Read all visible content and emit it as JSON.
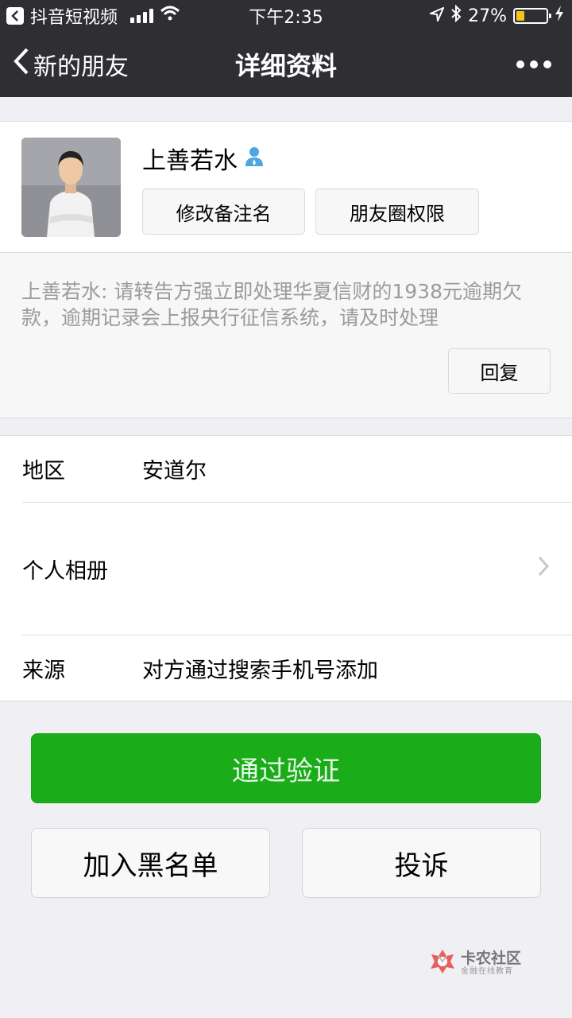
{
  "status_bar": {
    "back_app_label": "抖音短视频",
    "time": "下午2:35",
    "battery_text": "27%",
    "battery_level": 0.27
  },
  "nav": {
    "back_label": "新的朋友",
    "title": "详细资料"
  },
  "profile": {
    "name": "上善若水",
    "edit_remark_label": "修改备注名",
    "moments_permission_label": "朋友圈权限"
  },
  "message": {
    "text": "上善若水: 请转告方强立即处理华夏信财的1938元逾期欠款，逾期记录会上报央行征信系统，请及时处理",
    "reply_label": "回复"
  },
  "info": {
    "region": {
      "label": "地区",
      "value": "安道尔"
    },
    "album": {
      "label": "个人相册"
    },
    "source": {
      "label": "来源",
      "value": "对方通过搜索手机号添加"
    }
  },
  "actions": {
    "verify_label": "通过验证",
    "blacklist_label": "加入黑名单",
    "report_label": "投诉"
  },
  "watermark": {
    "main": "卡农社区",
    "sub": "金融在线教育"
  },
  "colors": {
    "nav_bg": "#2f2f33",
    "primary_green": "#1aad19",
    "page_bg": "#efeff4",
    "battery_yellow": "#f5c518"
  }
}
